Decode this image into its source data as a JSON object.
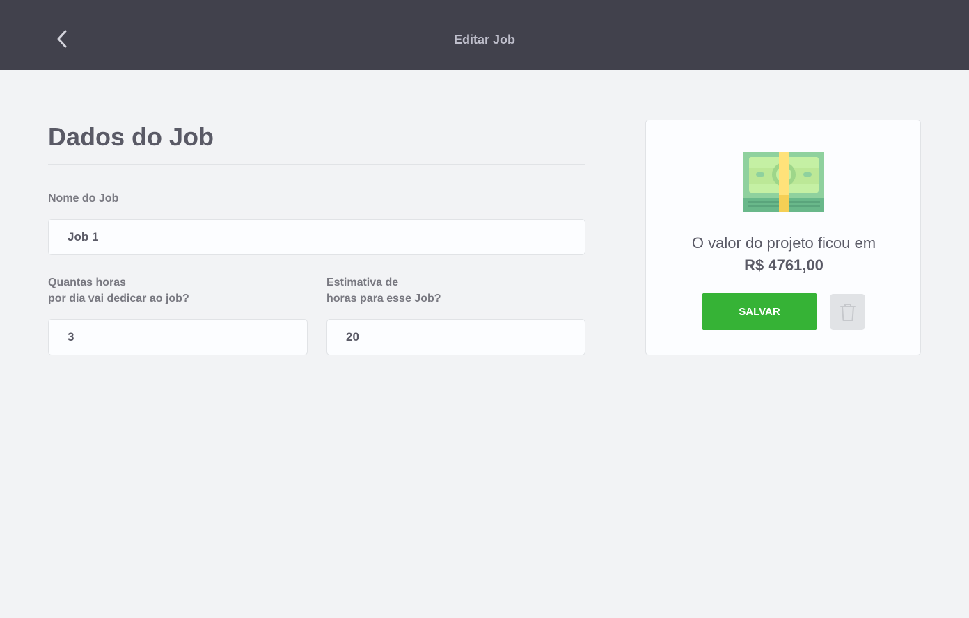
{
  "header": {
    "title": "Editar Job",
    "back_icon": "chevron-left-icon"
  },
  "form": {
    "title": "Dados do Job",
    "job_name_label": "Nome do Job",
    "job_name_value": "Job 1",
    "daily_hours_label_line1": "Quantas horas",
    "daily_hours_label_line2": "por dia vai dedicar ao job?",
    "daily_hours_value": "3",
    "total_hours_label_line1": "Estimativa de",
    "total_hours_label_line2": "horas para esse Job?",
    "total_hours_value": "20"
  },
  "summary": {
    "icon": "money-icon",
    "text": "O valor do projeto ficou em",
    "value": "R$ 4761,00",
    "save_label": "SALVAR",
    "delete_icon": "trash-icon"
  },
  "colors": {
    "header_bg": "#41414c",
    "page_bg": "#f2f3f5",
    "save_green": "#36b336",
    "text": "#5a5a66"
  }
}
